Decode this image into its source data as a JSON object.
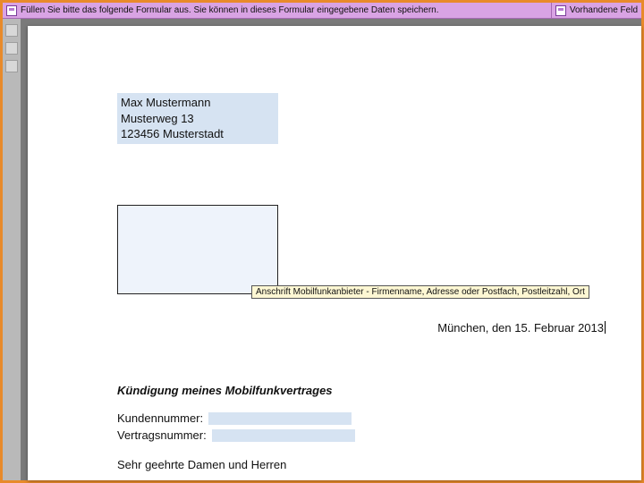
{
  "notification": {
    "message": "Füllen Sie bitte das folgende Formular aus. Sie können in dieses Formular eingegebene Daten speichern.",
    "right_label": "Vorhandene Feld"
  },
  "sender": {
    "name": "Max Mustermann",
    "street": "Musterweg 13",
    "city": "123456 Musterstadt"
  },
  "recipient_tooltip": "Anschrift Mobilfunkanbieter - Firmenname, Adresse oder Postfach, Postleitzahl, Ort",
  "place_date": "München, den 15. Februar 2013",
  "subject": "Kündigung meines Mobilfunkvertrages",
  "body": {
    "kundennummer_label": "Kundennummer:",
    "vertragsnummer_label": "Vertragsnummer:",
    "greeting": "Sehr geehrte Damen und Herren"
  }
}
